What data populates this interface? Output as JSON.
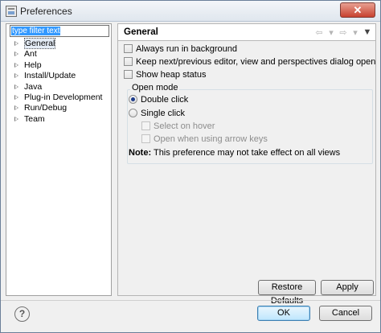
{
  "window": {
    "title": "Preferences",
    "close_label": "✕"
  },
  "filter": {
    "placeholder": "type filter text"
  },
  "tree": {
    "items": [
      {
        "label": "General",
        "selected": true
      },
      {
        "label": "Ant"
      },
      {
        "label": "Help"
      },
      {
        "label": "Install/Update"
      },
      {
        "label": "Java"
      },
      {
        "label": "Plug-in Development"
      },
      {
        "label": "Run/Debug"
      },
      {
        "label": "Team"
      }
    ]
  },
  "page": {
    "title": "General",
    "nav": {
      "back": "⇦",
      "back_menu": "▾",
      "forward": "⇨",
      "forward_menu": "▾",
      "view_menu": "▼"
    },
    "options": [
      {
        "label": "Always run in background",
        "checked": false
      },
      {
        "label": "Keep next/previous editor, view and perspectives dialog open",
        "checked": false
      },
      {
        "label": "Show heap status",
        "checked": false
      }
    ],
    "open_mode": {
      "legend": "Open mode",
      "double_click": "Double click",
      "single_click": "Single click",
      "select_on_hover": "Select on hover",
      "open_arrow_keys": "Open when using arrow keys",
      "note_label": "Note:",
      "note_text": "This preference may not take effect on all views"
    },
    "restore_defaults": "Restore Defaults",
    "apply": "Apply"
  },
  "footer": {
    "help": "?",
    "ok": "OK",
    "cancel": "Cancel"
  }
}
